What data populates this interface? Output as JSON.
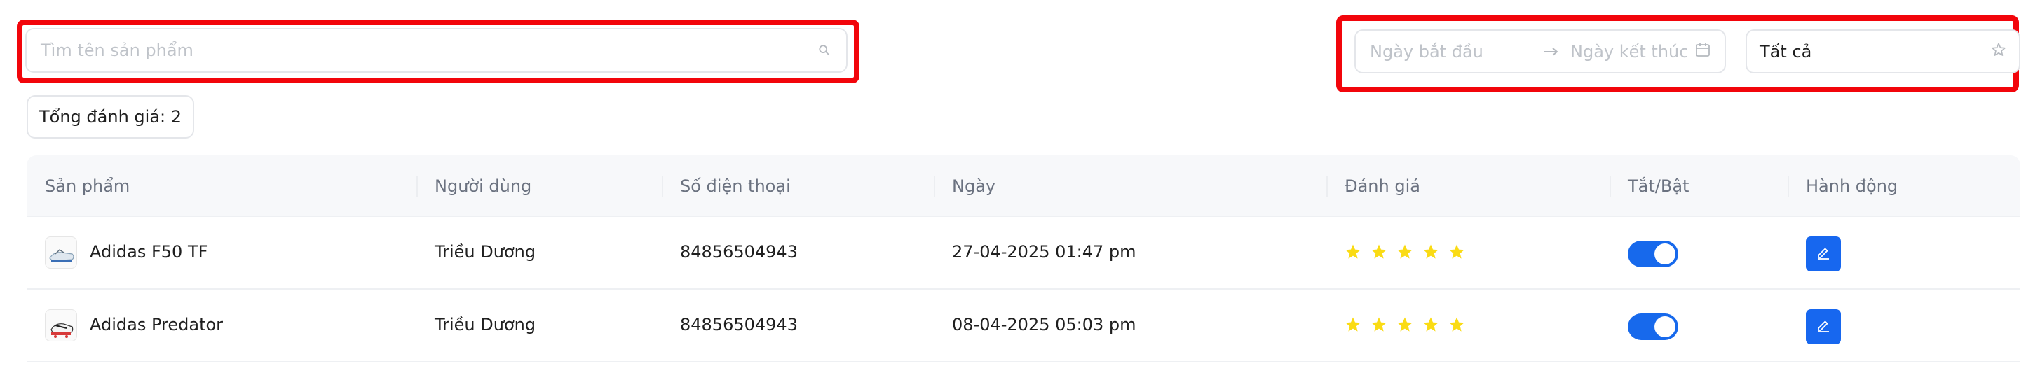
{
  "search": {
    "placeholder": "Tìm tên sản phẩm"
  },
  "date_range": {
    "start_placeholder": "Ngày bắt đầu",
    "end_placeholder": "Ngày kết thúc"
  },
  "status_filter": {
    "selected": "Tất cả"
  },
  "summary": {
    "total_reviews": "Tổng đánh giá: 2"
  },
  "table": {
    "columns": [
      "Sản phẩm",
      "Người dùng",
      "Số điện thoại",
      "Ngày",
      "Đánh giá",
      "Tắt/Bật",
      "Hành động"
    ],
    "rows": [
      {
        "product": "Adidas F50 TF",
        "user": "Triều Dương",
        "phone": "84856504943",
        "date": "27-04-2025 01:47 pm",
        "rating": 5,
        "enabled": true
      },
      {
        "product": "Adidas Predator",
        "user": "Triều Dương",
        "phone": "84856504943",
        "date": "08-04-2025 05:03 pm",
        "rating": 5,
        "enabled": true
      }
    ]
  },
  "colors": {
    "highlight": "#f2050b",
    "accent": "#1767ef",
    "star": "#fadb14"
  },
  "icons": {
    "search": "search-icon",
    "arrow": "arrow-right-icon",
    "calendar": "calendar-icon",
    "status": "star-outline-icon",
    "edit": "edit-icon"
  }
}
